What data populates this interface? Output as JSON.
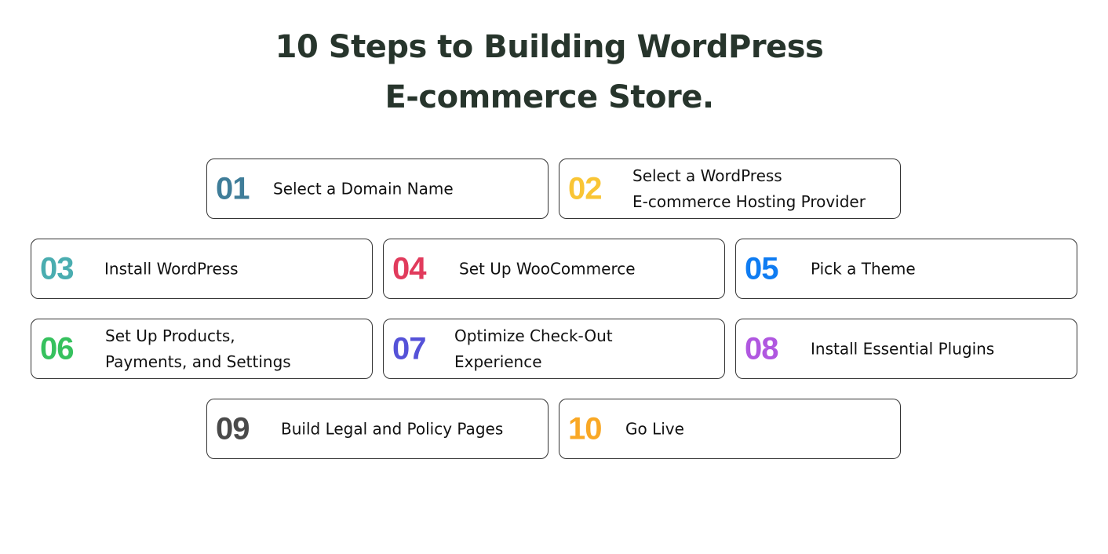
{
  "title": {
    "line1": "10 Steps to Building WordPress",
    "line2": "E-commerce Store."
  },
  "steps": [
    {
      "number": "01",
      "color": "#3f7d99",
      "lines": [
        "Select a Domain Name"
      ]
    },
    {
      "number": "02",
      "color": "#f9c535",
      "lines": [
        "Select a WordPress",
        "E-commerce Hosting Provider"
      ]
    },
    {
      "number": "03",
      "color": "#4aadb0",
      "lines": [
        "Install WordPress"
      ]
    },
    {
      "number": "04",
      "color": "#e13b5c",
      "lines": [
        "Set Up WooCommerce"
      ]
    },
    {
      "number": "05",
      "color": "#0f7cf2",
      "lines": [
        "Pick a Theme"
      ]
    },
    {
      "number": "06",
      "color": "#36c15e",
      "lines": [
        "Set Up Products,",
        "Payments, and Settings"
      ]
    },
    {
      "number": "07",
      "color": "#5552d8",
      "lines": [
        "Optimize Check-Out",
        "Experience"
      ]
    },
    {
      "number": "08",
      "color": "#b057e0",
      "lines": [
        "Install Essential Plugins"
      ]
    },
    {
      "number": "09",
      "color": "#4a4a4a",
      "lines": [
        "Build Legal and Policy Pages"
      ]
    },
    {
      "number": "10",
      "color": "#f9a825",
      "lines": [
        "Go Live"
      ]
    }
  ]
}
